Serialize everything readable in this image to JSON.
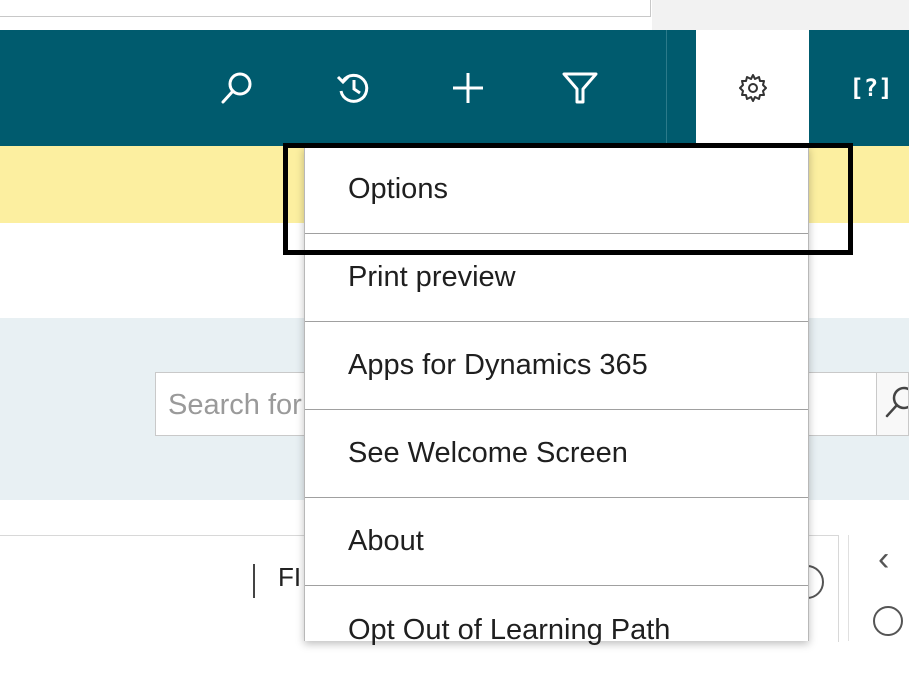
{
  "navbar": {
    "icons": [
      "search-icon",
      "recent-history-icon",
      "plus-icon",
      "filter-icon",
      "gear-icon",
      "help-icon"
    ],
    "help_text": "[?]",
    "background": "#005b6e"
  },
  "banner": {
    "color": "#fcefa0"
  },
  "search": {
    "placeholder": "Search for"
  },
  "list": {
    "column_header": "FI"
  },
  "settings_menu": {
    "items": [
      {
        "label": "Options",
        "highlighted": true
      },
      {
        "label": "Print preview"
      },
      {
        "label": "Apps for Dynamics 365"
      },
      {
        "label": "See Welcome Screen"
      },
      {
        "label": "About"
      },
      {
        "label": "Opt Out of Learning Path"
      }
    ]
  },
  "side_panel": {
    "collapse_glyph": "‹"
  },
  "annotation": {
    "color": "#000000"
  }
}
